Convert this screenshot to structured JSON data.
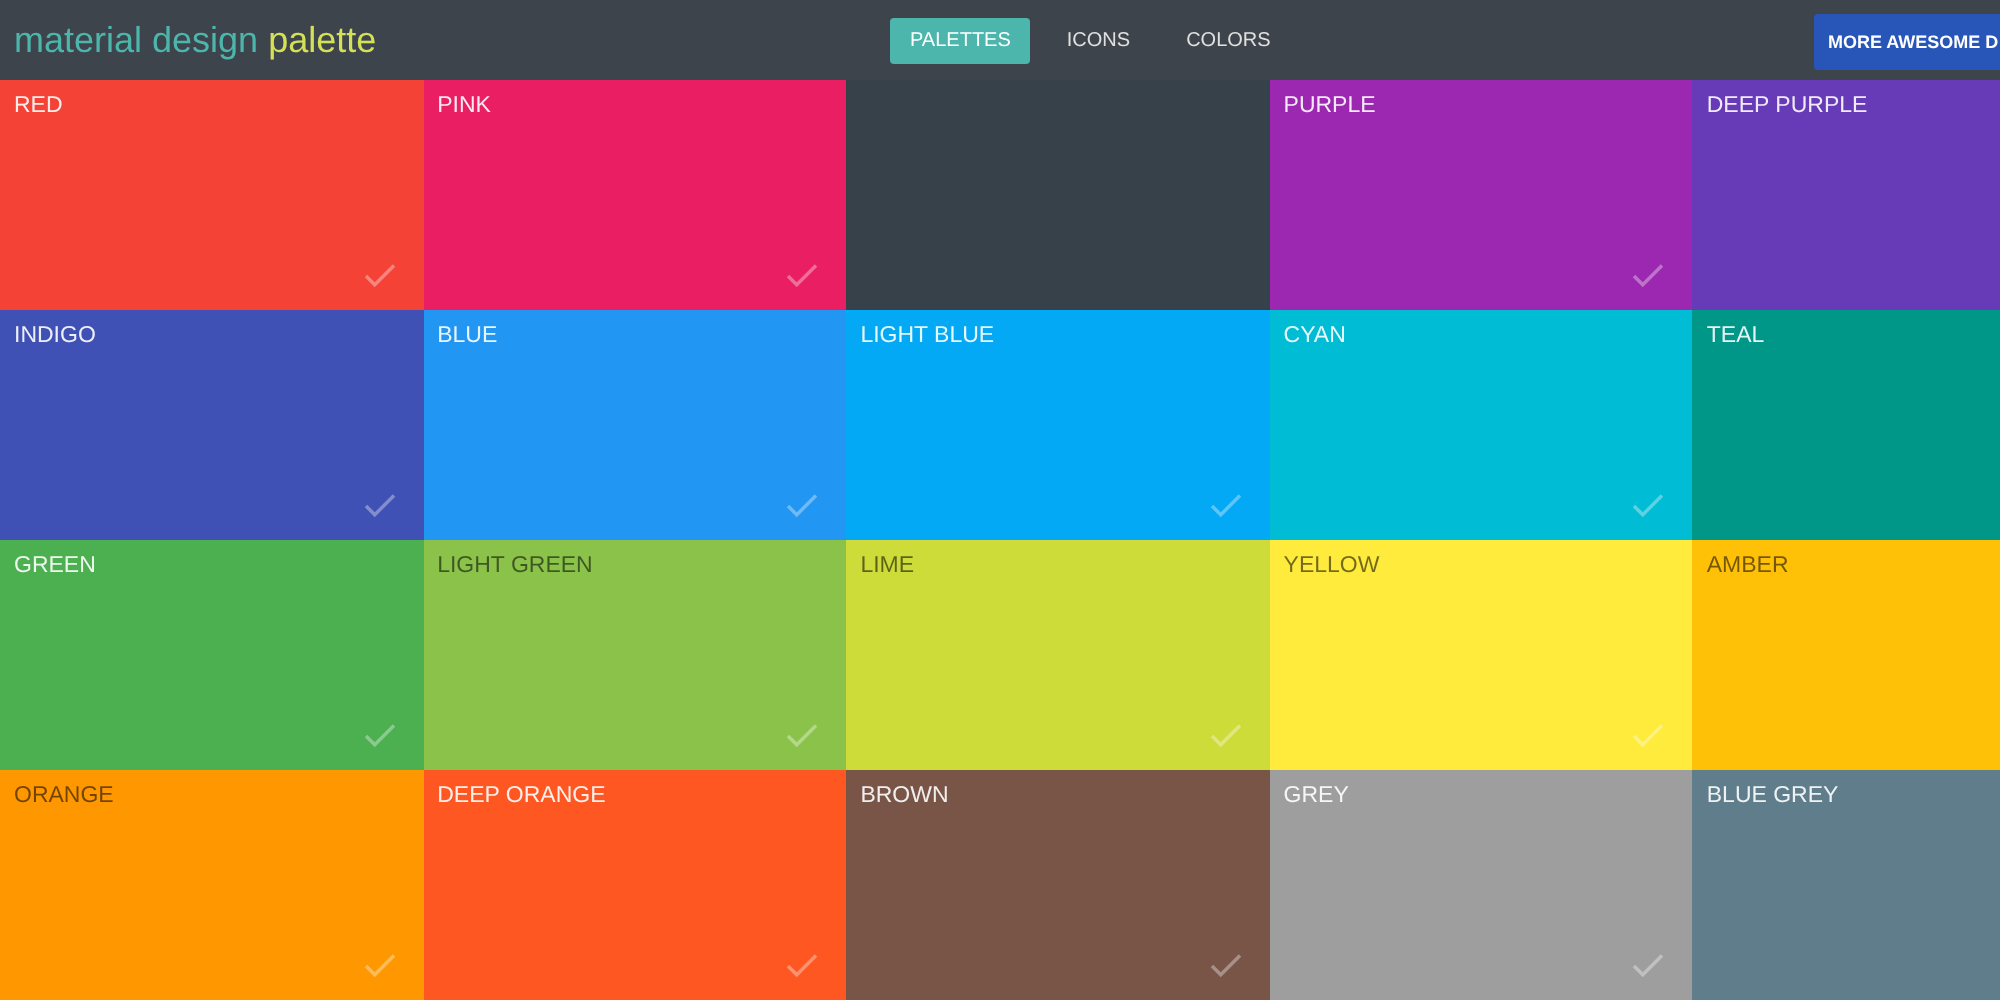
{
  "header": {
    "logo": {
      "part_1": "material design",
      "part_2": "palette"
    },
    "tabs": [
      {
        "label": "PALETTES",
        "selected": true
      },
      {
        "label": "ICONS",
        "selected": false
      },
      {
        "label": "COLORS",
        "selected": false
      }
    ],
    "button": "MORE AWESOME D"
  },
  "tiles": [
    {
      "kind": "color",
      "name": "RED",
      "color": "#f44336",
      "dark_label": false,
      "checked": true
    },
    {
      "kind": "color",
      "name": "PINK",
      "color": "#e91e63",
      "dark_label": false,
      "checked": true
    },
    {
      "kind": "blank",
      "color": "#37414a",
      "checked": false
    },
    {
      "kind": "color",
      "name": "PURPLE",
      "color": "#9c27b0",
      "dark_label": false,
      "checked": true
    },
    {
      "kind": "color",
      "name": "DEEP PURPLE",
      "color": "#673ab7",
      "dark_label": false,
      "checked": false
    },
    {
      "kind": "color",
      "name": "INDIGO",
      "color": "#3f51b5",
      "dark_label": false,
      "checked": true
    },
    {
      "kind": "color",
      "name": "BLUE",
      "color": "#2196f3",
      "dark_label": false,
      "checked": true
    },
    {
      "kind": "color",
      "name": "LIGHT BLUE",
      "color": "#03a9f4",
      "dark_label": false,
      "checked": true
    },
    {
      "kind": "color",
      "name": "CYAN",
      "color": "#00bcd4",
      "dark_label": false,
      "checked": true
    },
    {
      "kind": "color",
      "name": "TEAL",
      "color": "#009688",
      "dark_label": false,
      "checked": false
    },
    {
      "kind": "color",
      "name": "GREEN",
      "color": "#4caf50",
      "dark_label": false,
      "checked": true
    },
    {
      "kind": "color",
      "name": "LIGHT GREEN",
      "color": "#8bc34a",
      "dark_label": true,
      "checked": true
    },
    {
      "kind": "color",
      "name": "LIME",
      "color": "#cddc39",
      "dark_label": true,
      "checked": true
    },
    {
      "kind": "color",
      "name": "YELLOW",
      "color": "#ffeb3b",
      "dark_label": true,
      "checked": true
    },
    {
      "kind": "color",
      "name": "AMBER",
      "color": "#ffc107",
      "dark_label": true,
      "checked": false
    },
    {
      "kind": "color",
      "name": "ORANGE",
      "color": "#ff9800",
      "dark_label": true,
      "checked": true
    },
    {
      "kind": "color",
      "name": "DEEP ORANGE",
      "color": "#ff5722",
      "dark_label": false,
      "checked": true
    },
    {
      "kind": "color",
      "name": "BROWN",
      "color": "#795548",
      "dark_label": false,
      "checked": true
    },
    {
      "kind": "color",
      "name": "GREY",
      "color": "#9e9e9e",
      "dark_label": false,
      "checked": true
    },
    {
      "kind": "color",
      "name": "BLUE GREY",
      "color": "#607d8b",
      "dark_label": false,
      "checked": false
    }
  ]
}
